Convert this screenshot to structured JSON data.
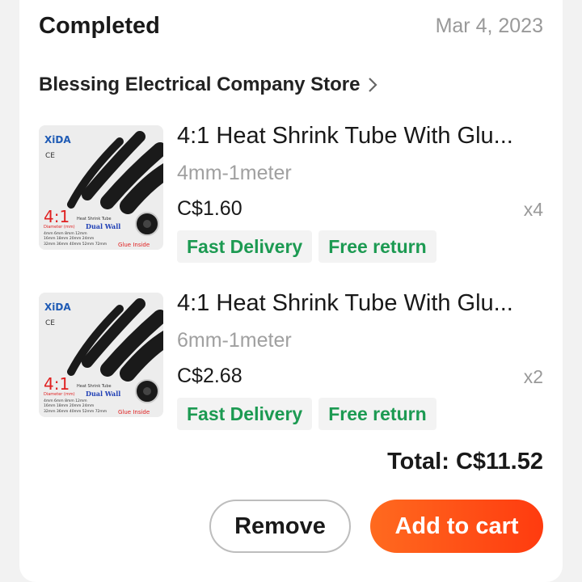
{
  "order": {
    "status": "Completed",
    "date": "Mar 4, 2023",
    "store_name": "Blessing Electrical Company Store",
    "total": "Total: C$11.52"
  },
  "items": [
    {
      "title": "4:1 Heat Shrink Tube With Glu...",
      "variant": "4mm-1meter",
      "price": "C$1.60",
      "quantity": "x4",
      "tags": [
        "Fast Delivery",
        "Free return"
      ],
      "thumb": {
        "brand": "XiDA",
        "mark": "CE",
        "ratio": "4:1",
        "label": "Heat Shrink Tube",
        "diameter_label": "Diameter (mm)",
        "wall": "Dual Wall",
        "sizes_row1": "4mm 6mm 8mm 12mm",
        "sizes_row2": "16mm 18mm 20mm 24mm",
        "sizes_row3": "32mm 36mm 40mm 52mm 72mm",
        "glue": "Glue Inside"
      }
    },
    {
      "title": "4:1 Heat Shrink Tube With Glu...",
      "variant": "6mm-1meter",
      "price": "C$2.68",
      "quantity": "x2",
      "tags": [
        "Fast Delivery",
        "Free return"
      ],
      "thumb": {
        "brand": "XiDA",
        "mark": "CE",
        "ratio": "4:1",
        "label": "Heat Shrink Tube",
        "diameter_label": "Diameter (mm)",
        "wall": "Dual Wall",
        "sizes_row1": "4mm 6mm 8mm 12mm",
        "sizes_row2": "16mm 18mm 20mm 24mm",
        "sizes_row3": "32mm 36mm 40mm 52mm 72mm",
        "glue": "Glue Inside"
      }
    }
  ],
  "actions": {
    "remove_label": "Remove",
    "add_to_cart_label": "Add to cart"
  },
  "colors": {
    "accent": "#ff4d14",
    "tag_text": "#1c9a52",
    "muted": "#999999"
  },
  "icons": {
    "store_chevron": "chevron-right-icon"
  }
}
